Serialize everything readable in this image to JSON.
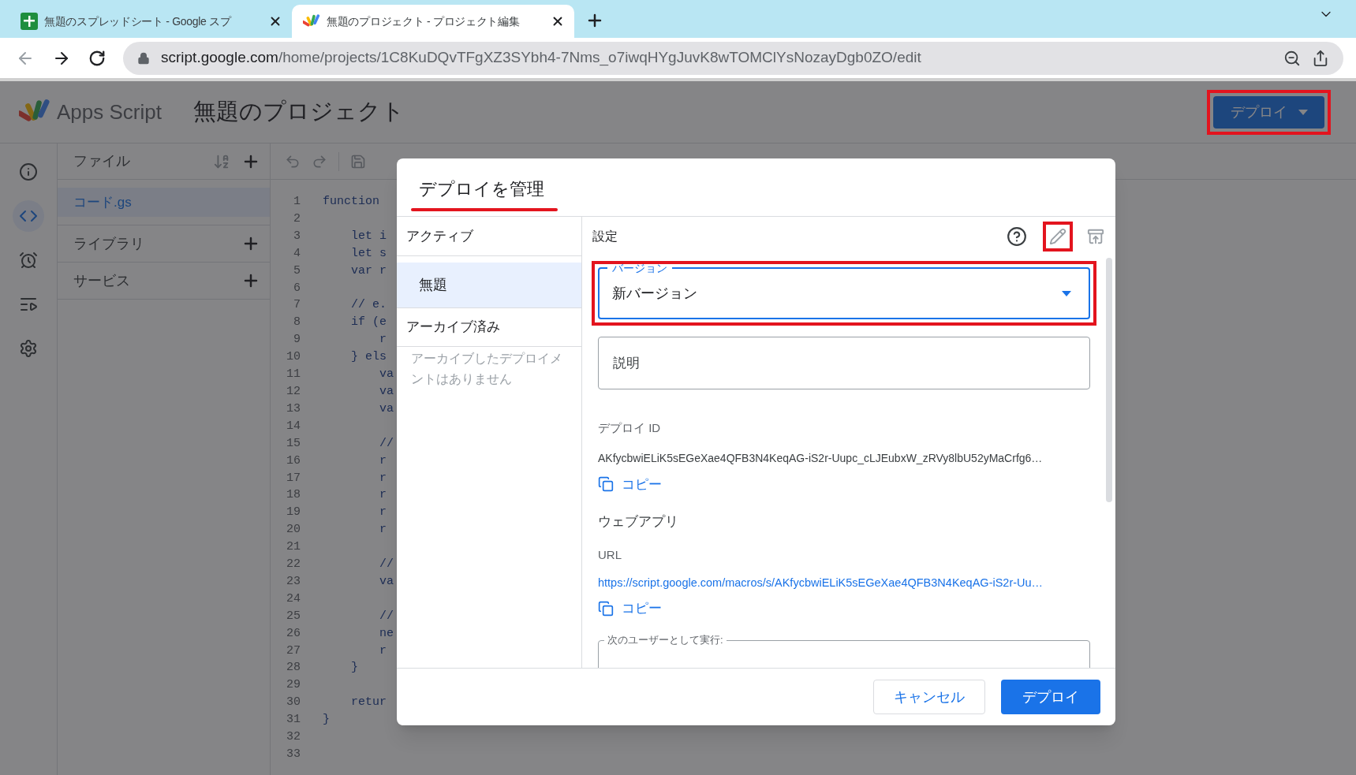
{
  "browser": {
    "tabs": [
      {
        "title": "無題のスプレッドシート - Google スプ",
        "kind": "sheets",
        "selected": false
      },
      {
        "title": "無題のプロジェクト - プロジェクト編集",
        "kind": "script",
        "selected": true
      }
    ],
    "url_host": "script.google.com",
    "url_path": "/home/projects/1C8KuDQvTFgXZ3SYbh4-7Nms_o7iwqHYgJuvK8wTOMClYsNozayDgb0ZO/edit"
  },
  "app": {
    "name": "Apps Script",
    "project_title": "無題のプロジェクト",
    "deploy_button": {
      "label": "デプロイ",
      "highlighted": true
    }
  },
  "rail": [
    {
      "kind": "info",
      "selected": false
    },
    {
      "kind": "code",
      "selected": true
    },
    {
      "kind": "triggers",
      "selected": false
    },
    {
      "kind": "executions",
      "selected": false
    },
    {
      "kind": "settings",
      "selected": false
    }
  ],
  "files": {
    "title": "ファイル",
    "items": [
      {
        "name": "コード.gs",
        "selected": true
      }
    ]
  },
  "sections": [
    {
      "title": "ライブラリ"
    },
    {
      "title": "サービス"
    }
  ],
  "editor": {
    "lines": [
      {
        "number": "1",
        "code": "function"
      },
      {
        "number": "2"
      },
      {
        "number": "3",
        "code": "    let i"
      },
      {
        "number": "4",
        "code": "    let s"
      },
      {
        "number": "5",
        "code": "    var r"
      },
      {
        "number": "6"
      },
      {
        "number": "7",
        "code": "    // e."
      },
      {
        "number": "8",
        "code": "    if (e"
      },
      {
        "number": "9",
        "code": "        r"
      },
      {
        "number": "10",
        "code": "    } els"
      },
      {
        "number": "11",
        "code": "        va"
      },
      {
        "number": "12",
        "code": "        va"
      },
      {
        "number": "13",
        "code": "        va"
      },
      {
        "number": "14"
      },
      {
        "number": "15",
        "code": "        //"
      },
      {
        "number": "16",
        "code": "        r"
      },
      {
        "number": "17",
        "code": "        r"
      },
      {
        "number": "18",
        "code": "        r"
      },
      {
        "number": "19",
        "code": "        r"
      },
      {
        "number": "20",
        "code": "        r"
      },
      {
        "number": "21"
      },
      {
        "number": "22",
        "code": "        //"
      },
      {
        "number": "23",
        "code": "        va"
      },
      {
        "number": "24"
      },
      {
        "number": "25",
        "code": "        //"
      },
      {
        "number": "26",
        "code": "        ne"
      },
      {
        "number": "27",
        "code": "        r"
      },
      {
        "number": "28",
        "code": "    }"
      },
      {
        "number": "29"
      },
      {
        "number": "30",
        "code": "    retur"
      },
      {
        "number": "31",
        "code": "}"
      },
      {
        "number": "32"
      },
      {
        "number": "33"
      }
    ]
  },
  "dialog": {
    "title": "デプロイを管理",
    "title_underlined": true,
    "active_heading": "アクティブ",
    "deployments": [
      {
        "name": "無題",
        "selected": true
      }
    ],
    "archived_heading": "アーカイブ済み",
    "archived_note": "アーカイブしたデプロイメントはありません",
    "settings_heading": "設定",
    "edit_highlighted": true,
    "version": {
      "label": "バージョン",
      "value": "新バージョン",
      "highlighted": true
    },
    "description": {
      "placeholder": "説明"
    },
    "deploy_id_label": "デプロイ ID",
    "deploy_id": "AKfycbwiELiK5sEGeXae4QFB3N4KeqAG-iS2r-Uupc_cLJEubxW_zRVy8lbU52yMaCrfg6…",
    "copy_label": "コピー",
    "webapp_heading": "ウェブアプリ",
    "url_label": "URL",
    "url": "https://script.google.com/macros/s/AKfycbwiELiK5sEGeXae4QFB3N4KeqAG-iS2r-Uu…",
    "copy_label_2": "コピー",
    "run_as_label": "次のユーザーとして実行:",
    "cancel": "キャンセル",
    "deploy": "デプロイ"
  }
}
